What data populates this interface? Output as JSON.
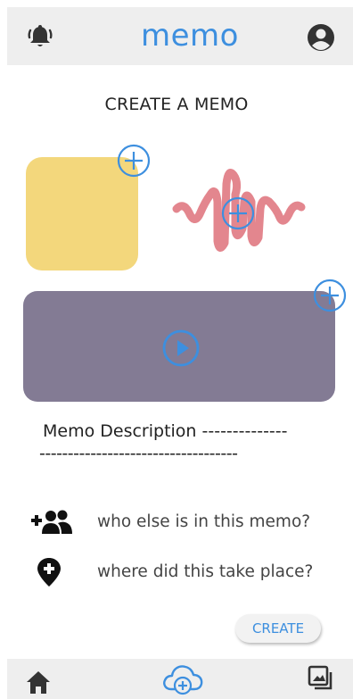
{
  "header": {
    "title": "memo",
    "left_icon": "bell-icon",
    "right_icon": "account-circle-icon"
  },
  "create": {
    "heading": "CREATE A MEMO",
    "description_label": "Memo Description --------------",
    "description_line2": "-----------------------------------",
    "people_prompt": "who else is in this memo?",
    "place_prompt": "where did this take place?",
    "create_button": "CREATE"
  },
  "footer": {
    "icons": [
      "home-icon",
      "cloud-add-icon",
      "photo-gallery-icon"
    ]
  },
  "colors": {
    "accent": "#3d8fdf",
    "photo_card": "#f3d77c",
    "video_card": "#837b94",
    "waveform": "#e3868e",
    "bar": "#eeeeee"
  }
}
